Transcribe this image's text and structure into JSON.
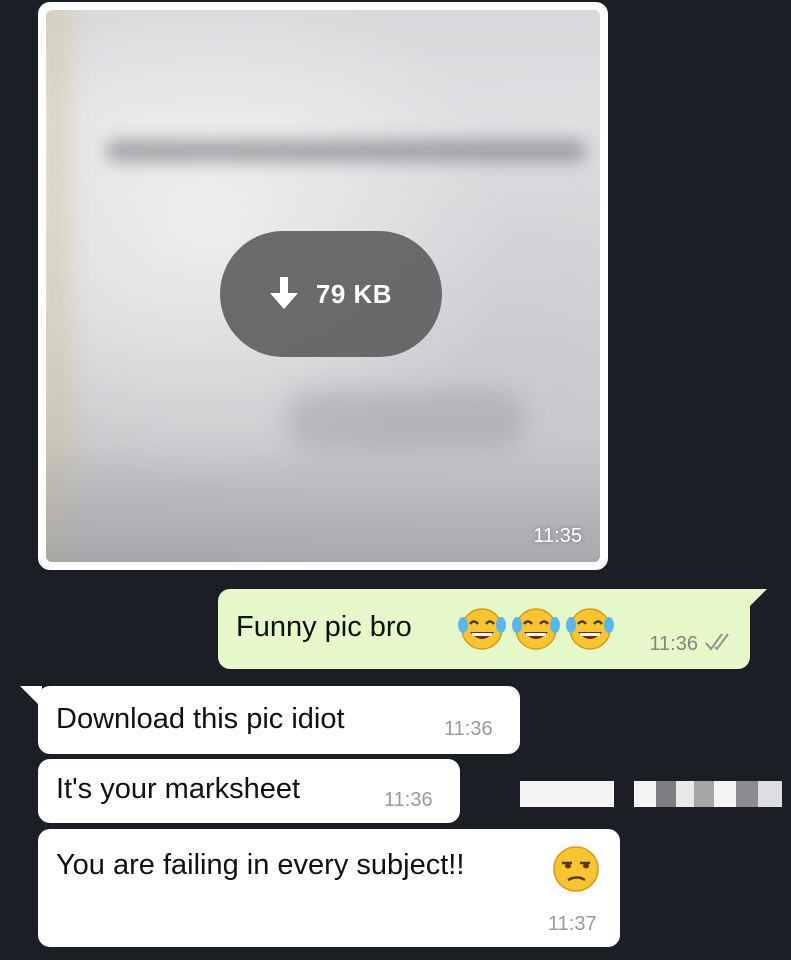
{
  "image_message": {
    "size_label": "79 KB",
    "time": "11:35",
    "download_icon": "download-arrow-icon"
  },
  "outgoing": {
    "text": "Funny pic bro",
    "emojis": [
      "joy-emoji",
      "joy-emoji",
      "joy-emoji"
    ],
    "time": "11:36",
    "status_icon": "double-check-icon"
  },
  "incoming": [
    {
      "text": "Download this pic idiot",
      "time": "11:36"
    },
    {
      "text": "It's your marksheet",
      "time": "11:36"
    },
    {
      "text": "You are failing in every subject!!",
      "emoji": "unamused-face-emoji",
      "time": "11:37"
    }
  ],
  "colors": {
    "background": "#1b1f25",
    "outgoing_bubble": "#e5f8c9",
    "incoming_bubble": "#ffffff"
  }
}
